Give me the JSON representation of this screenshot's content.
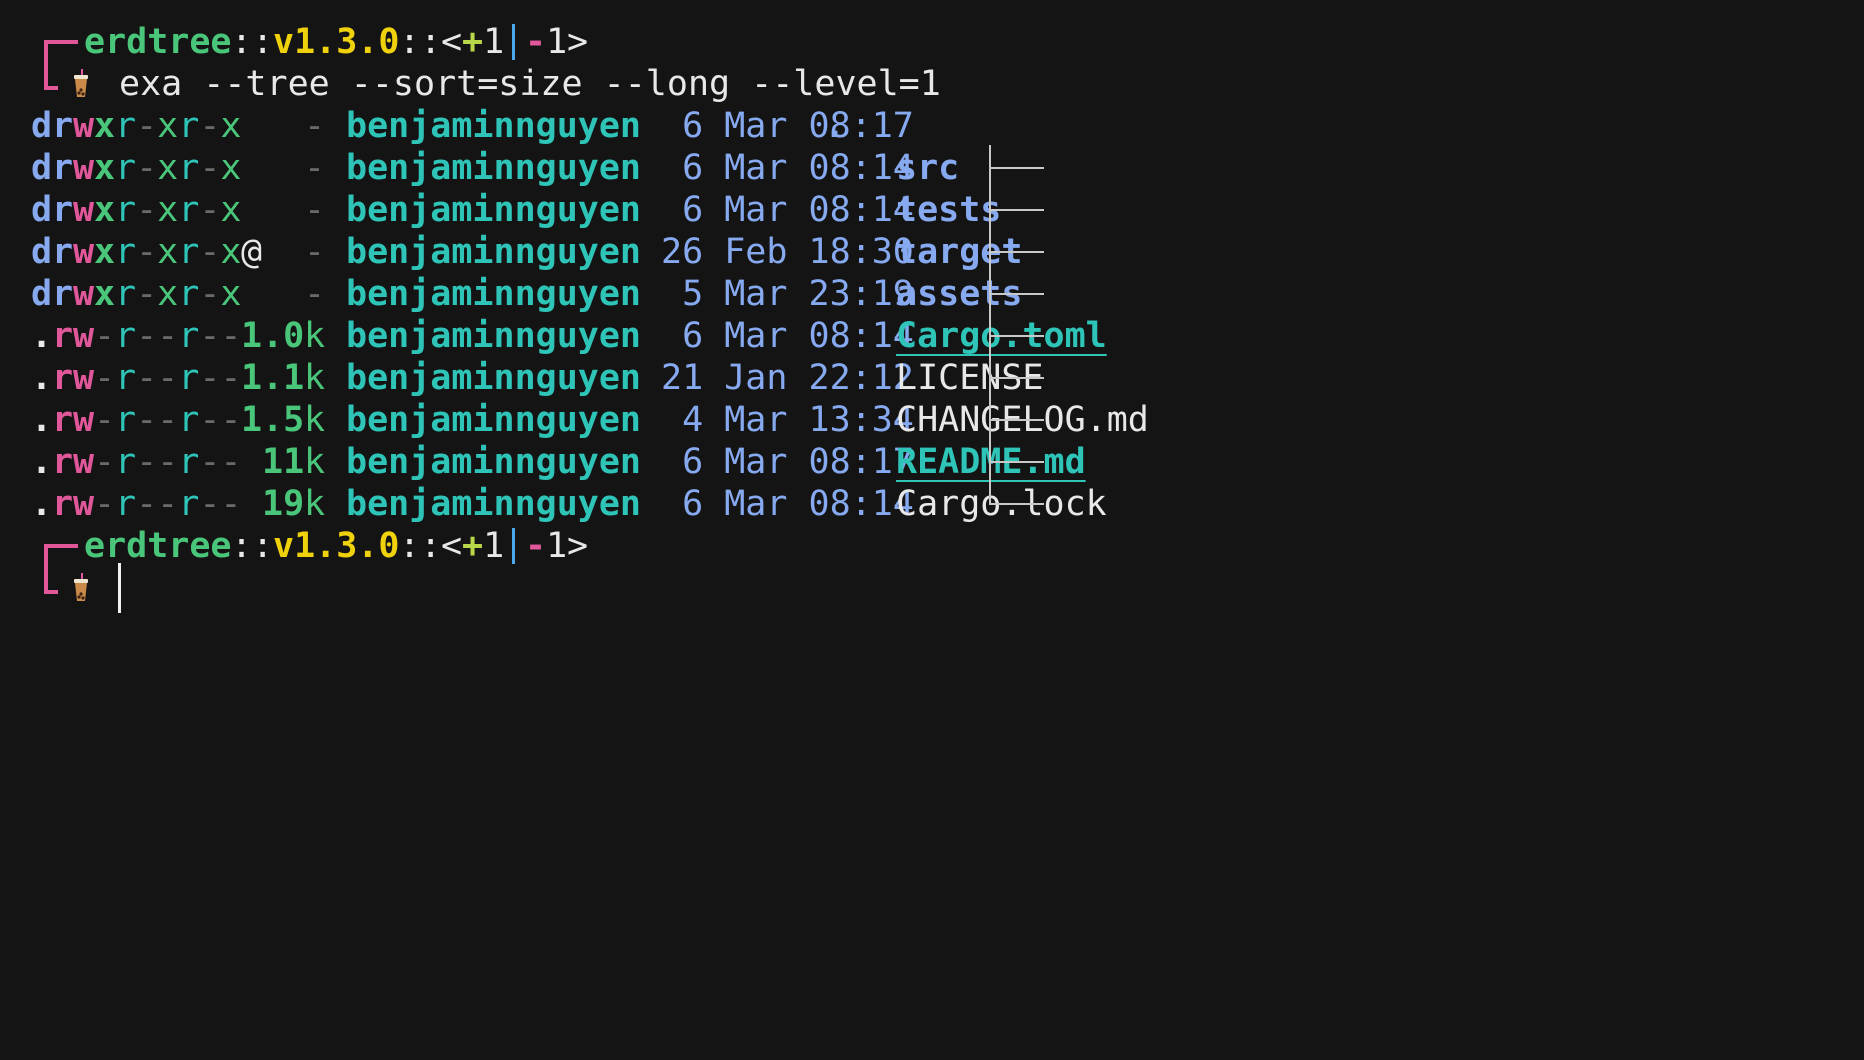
{
  "prompt": {
    "name": "erdtree",
    "sep1": "::",
    "version": "v1.3.0",
    "sep2": "::",
    "git_open": "<",
    "git_plus": "+1",
    "git_minus": "-1",
    "git_close": ">"
  },
  "command": "exa --tree --sort=size --long --level=1",
  "rows": [
    {
      "d": "d",
      "r": "r",
      "w": "w",
      "x": "x",
      "rest": "r-xr-x",
      "xattr": "",
      "size_num": "",
      "size_unit": "-",
      "user": "benjaminnguyen",
      "date": " 6 Mar 08:17",
      "name": ".",
      "name_type": "root"
    },
    {
      "d": "d",
      "r": "r",
      "w": "w",
      "x": "x",
      "rest": "r-xr-x",
      "xattr": "",
      "size_num": "",
      "size_unit": "-",
      "user": "benjaminnguyen",
      "date": " 6 Mar 08:14",
      "name": "src",
      "name_type": "dir"
    },
    {
      "d": "d",
      "r": "r",
      "w": "w",
      "x": "x",
      "rest": "r-xr-x",
      "xattr": "",
      "size_num": "",
      "size_unit": "-",
      "user": "benjaminnguyen",
      "date": " 6 Mar 08:14",
      "name": "tests",
      "name_type": "dir"
    },
    {
      "d": "d",
      "r": "r",
      "w": "w",
      "x": "x",
      "rest": "r-xr-x",
      "xattr": "@",
      "size_num": "",
      "size_unit": "-",
      "user": "benjaminnguyen",
      "date": "26 Feb 18:30",
      "name": "target",
      "name_type": "dir"
    },
    {
      "d": "d",
      "r": "r",
      "w": "w",
      "x": "x",
      "rest": "r-xr-x",
      "xattr": "",
      "size_num": "",
      "size_unit": "-",
      "user": "benjaminnguyen",
      "date": " 5 Mar 23:19",
      "name": "assets",
      "name_type": "dir"
    },
    {
      "d": ".",
      "r": "r",
      "w": "w",
      "x": "-",
      "rest": "r--r--",
      "xattr": "",
      "size_num": "1.0",
      "size_unit": "k",
      "user": "benjaminnguyen",
      "date": " 6 Mar 08:14",
      "name": "Cargo.toml",
      "name_type": "special"
    },
    {
      "d": ".",
      "r": "r",
      "w": "w",
      "x": "-",
      "rest": "r--r--",
      "xattr": "",
      "size_num": "1.1",
      "size_unit": "k",
      "user": "benjaminnguyen",
      "date": "21 Jan 22:12",
      "name": "LICENSE",
      "name_type": "file"
    },
    {
      "d": ".",
      "r": "r",
      "w": "w",
      "x": "-",
      "rest": "r--r--",
      "xattr": "",
      "size_num": "1.5",
      "size_unit": "k",
      "user": "benjaminnguyen",
      "date": " 4 Mar 13:34",
      "name": "CHANGELOG.md",
      "name_type": "file"
    },
    {
      "d": ".",
      "r": "r",
      "w": "w",
      "x": "-",
      "rest": "r--r--",
      "xattr": "",
      "size_num": "11",
      "size_unit": "k",
      "user": "benjaminnguyen",
      "date": " 6 Mar 08:17",
      "name": "README.md",
      "name_type": "special"
    },
    {
      "d": ".",
      "r": "r",
      "w": "w",
      "x": "-",
      "rest": "r--r--",
      "xattr": "",
      "size_num": "19",
      "size_unit": "k",
      "user": "benjaminnguyen",
      "date": " 6 Mar 08:14",
      "name": "Cargo.lock",
      "name_type": "file"
    }
  ],
  "icons": {
    "prompt_corner": "corner-bracket-icon",
    "prompt_char": "boba-tea-icon"
  },
  "colors": {
    "background": "#141414",
    "text": "#e8e8e8",
    "green": "#4ac67a",
    "teal": "#2fc4b8",
    "blue": "#86a9f0",
    "pink": "#e0579a",
    "yellow": "#f0d20c",
    "yellow_green": "#b8d84a",
    "tree": "#c8c8c8",
    "dim_dash": "#6a6a6a",
    "git_pipe": "#4aa8e8"
  }
}
